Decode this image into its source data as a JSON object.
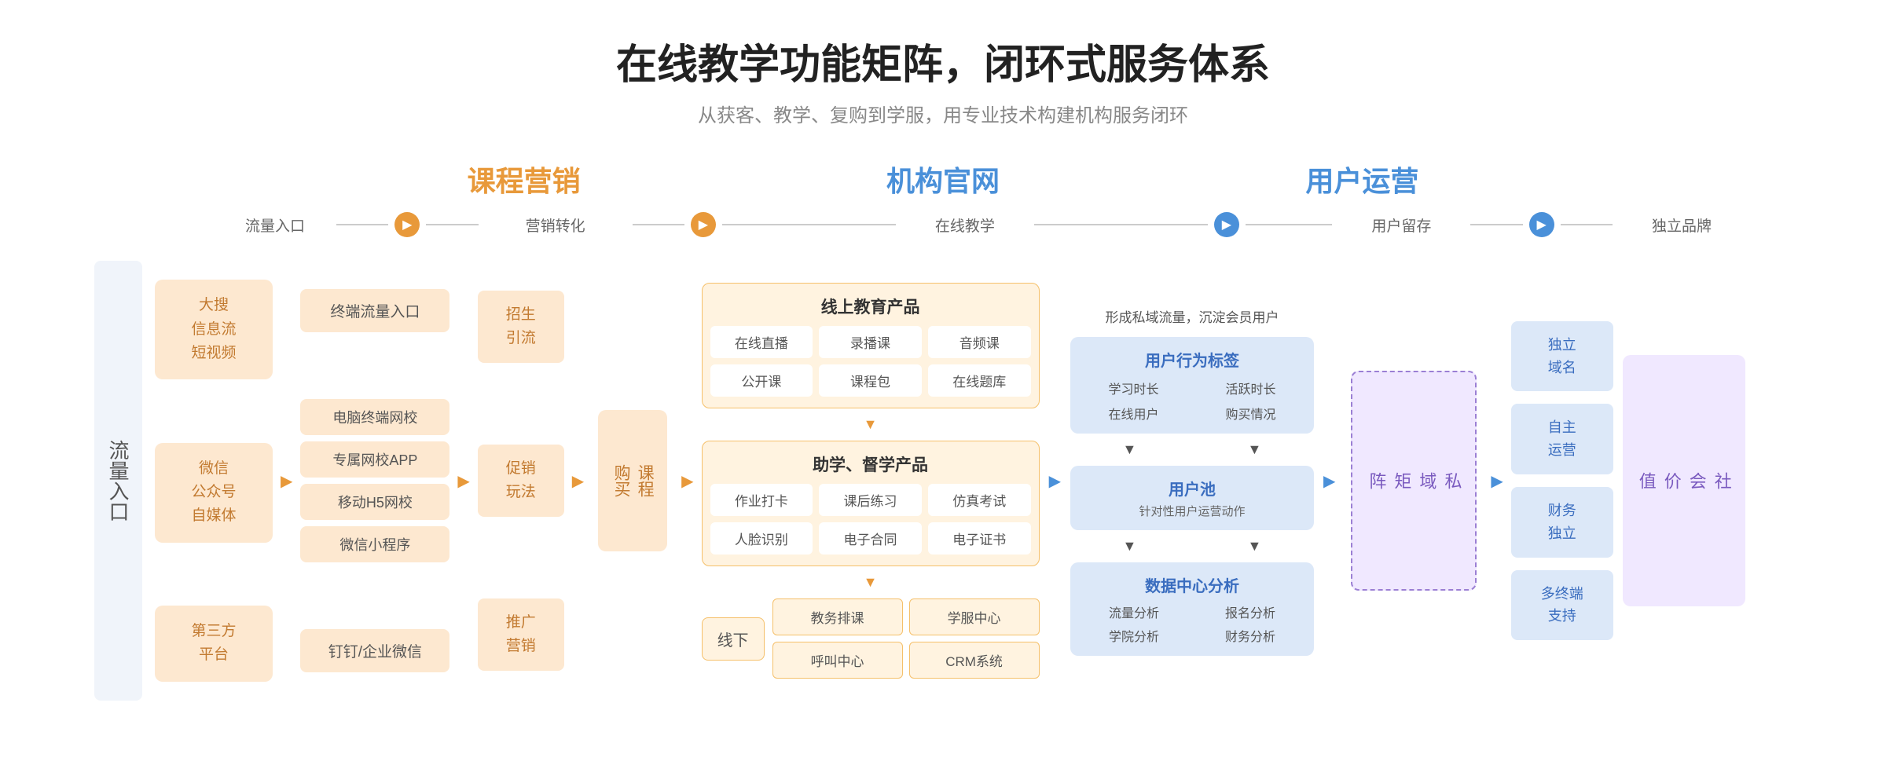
{
  "header": {
    "title": "在线教学功能矩阵，闭环式服务体系",
    "subtitle": "从获客、教学、复购到学服，用专业技术构建机构服务闭环"
  },
  "sections": {
    "marketing": "课程营销",
    "official_site": "机构官网",
    "user_ops": "用户运营"
  },
  "flow_labels": {
    "traffic_entry": "流量入口",
    "marketing_convert": "营销转化",
    "online_teaching": "在线教学",
    "user_retention": "用户留存",
    "independent_brand": "独立品牌"
  },
  "left_label": "流量入口",
  "traffic_sources": [
    "大搜\n信息流\n短视频",
    "微信\n公众号\n自媒体",
    "第三方\n平台"
  ],
  "marketing_items": [
    "终端流量入口",
    "电脑终端网校",
    "专属网校APP",
    "移动H5网校",
    "微信小程序",
    "钉钉/企业微信"
  ],
  "convert_items": [
    "招生\n引流",
    "促销\n玩法",
    "推广\n营销"
  ],
  "course_buy": "课程\n购买",
  "online_edu_title": "线上教育产品",
  "online_edu_items": [
    "在线直播",
    "录播课",
    "音频课",
    "公开课",
    "课程包",
    "在线题库"
  ],
  "supervision_title": "助学、督学产品",
  "supervision_items": [
    "作业打卡",
    "课后练习",
    "仿真考试",
    "人脸识别",
    "电子合同",
    "电子证书"
  ],
  "offline_label": "线下",
  "offline_items": [
    "教务排课",
    "学服中心",
    "呼叫中心",
    "CRM系统"
  ],
  "retention_text": "形成私域流量，沉淀会员用户",
  "user_behavior_title": "用户行为标签",
  "behavior_items": [
    "学习时长",
    "活跃时长",
    "在线用户",
    "购买情况"
  ],
  "user_pool_title": "用户池",
  "user_pool_sub": "针对性用户运营动作",
  "data_analysis_title": "数据中心分析",
  "data_items": [
    "流量分析",
    "报名分析",
    "学院分析",
    "财务分析"
  ],
  "private_domain": "私\n域\n矩\n阵",
  "brand_items": [
    "独立\n域名",
    "自主\n运营",
    "财务\n独立",
    "多终端\n支持"
  ],
  "social_value": "社\n会\n价\n值"
}
